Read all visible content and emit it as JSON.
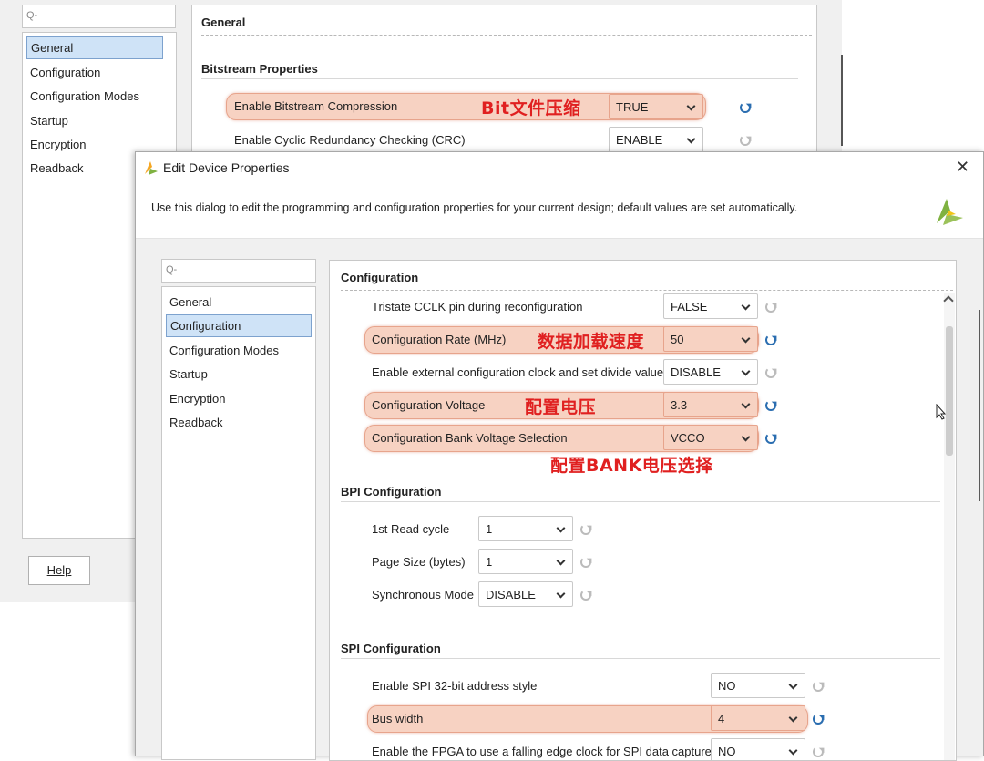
{
  "background_dialog": {
    "search_placeholder": "Q-",
    "nav_items": [
      "General",
      "Configuration",
      "Configuration Modes",
      "Startup",
      "Encryption",
      "Readback"
    ],
    "selected_nav": "General",
    "help_label": "Help",
    "section_title": "General",
    "subsection_title": "Bitstream Properties",
    "properties": [
      {
        "label": "Enable Bitstream Compression",
        "value": "TRUE",
        "highlighted": true,
        "annotation": "Bit文件压缩"
      },
      {
        "label": "Enable Cyclic Redundancy Checking (CRC)",
        "value": "ENABLE",
        "highlighted": false
      }
    ]
  },
  "dialog": {
    "title": "Edit Device Properties",
    "close_glyph": "✕",
    "description": "Use this dialog to edit the programming and configuration properties for your current design; default values are set automatically.",
    "search_placeholder": "Q-",
    "nav_items": [
      "General",
      "Configuration",
      "Configuration Modes",
      "Startup",
      "Encryption",
      "Readback"
    ],
    "selected_nav": "Configuration",
    "section_title": "Configuration",
    "config_properties": [
      {
        "label": "Tristate CCLK pin during reconfiguration",
        "value": "FALSE",
        "highlighted": false
      },
      {
        "label": "Configuration Rate (MHz)",
        "value": "50",
        "highlighted": true,
        "annotation": "数据加载速度"
      },
      {
        "label": "Enable external configuration clock and set divide value",
        "value": "DISABLE",
        "highlighted": false
      },
      {
        "label": "Configuration Voltage",
        "value": "3.3",
        "highlighted": true,
        "annotation": "配置电压"
      },
      {
        "label": "Configuration Bank Voltage Selection",
        "value": "VCCO",
        "highlighted": true,
        "annotation": "配置BANK电压选择"
      }
    ],
    "bpi_title": "BPI Configuration",
    "bpi_properties": [
      {
        "label": "1st Read cycle",
        "value": "1"
      },
      {
        "label": "Page Size (bytes)",
        "value": "1"
      },
      {
        "label": "Synchronous Mode",
        "value": "DISABLE"
      }
    ],
    "spi_title": "SPI Configuration",
    "spi_properties": [
      {
        "label": "Enable SPI 32-bit address style",
        "value": "NO",
        "highlighted": false
      },
      {
        "label": "Bus width",
        "value": "4",
        "highlighted": true
      },
      {
        "label": "Enable the FPGA to use a falling edge clock for SPI data capture",
        "value": "NO",
        "highlighted": false
      }
    ]
  },
  "colors": {
    "highlight": "#f7d2c2",
    "annotation": "#e02020",
    "selection": "#cfe3f7",
    "reset_active": "#2a6db0"
  }
}
